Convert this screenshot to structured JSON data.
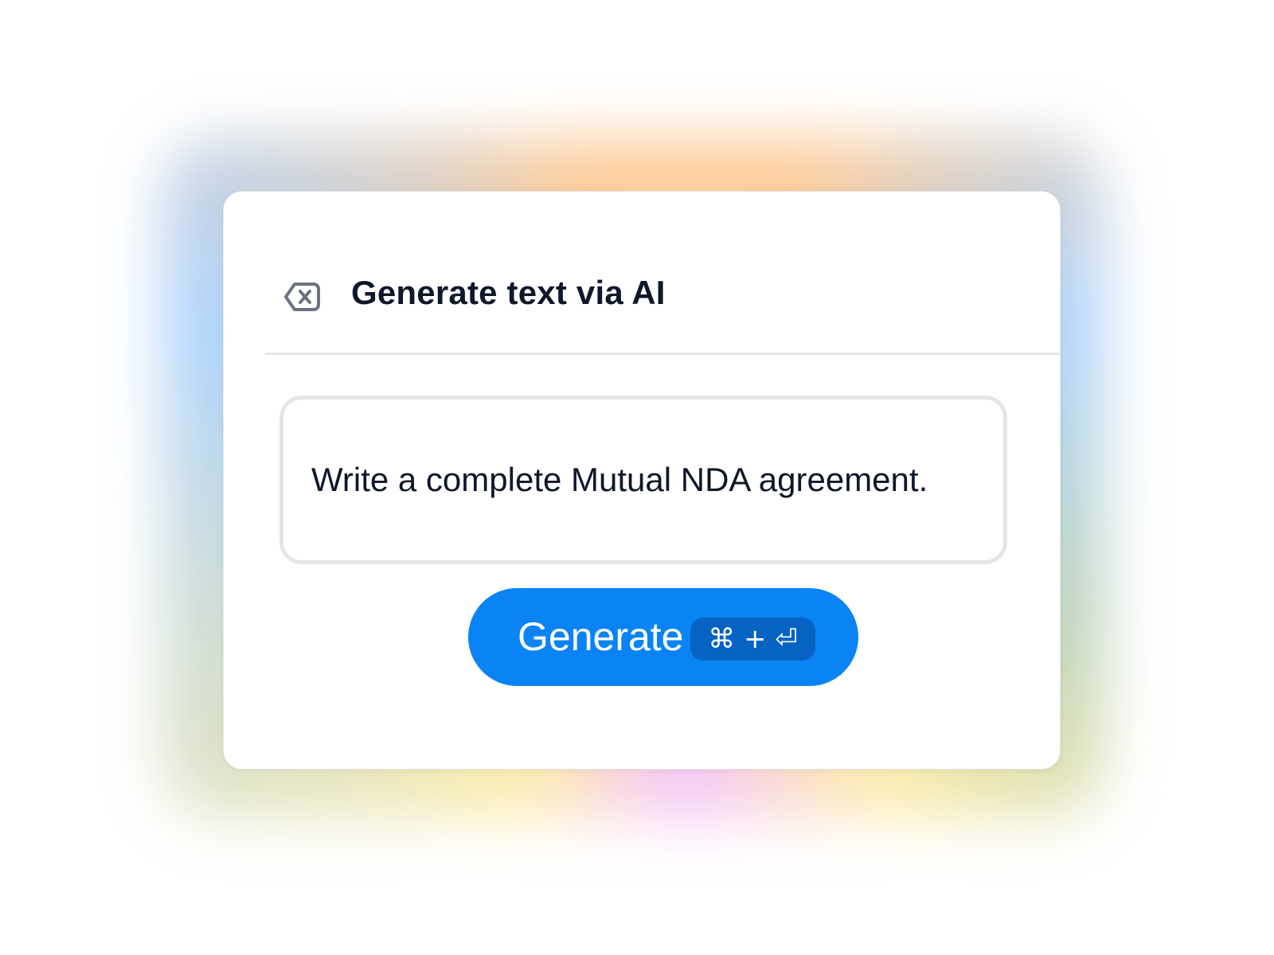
{
  "dialog": {
    "title": "Generate text via AI",
    "back_icon": "backspace-close-icon"
  },
  "prompt": {
    "value": "Write a complete Mutual NDA agreement."
  },
  "generate_button": {
    "label": "Generate",
    "shortcut": "⌘ + ⏎"
  },
  "colors": {
    "accent": "#0a84f5",
    "shortcut_bg": "#0663c4",
    "text": "#0f172a",
    "border": "#e5e5e5"
  }
}
